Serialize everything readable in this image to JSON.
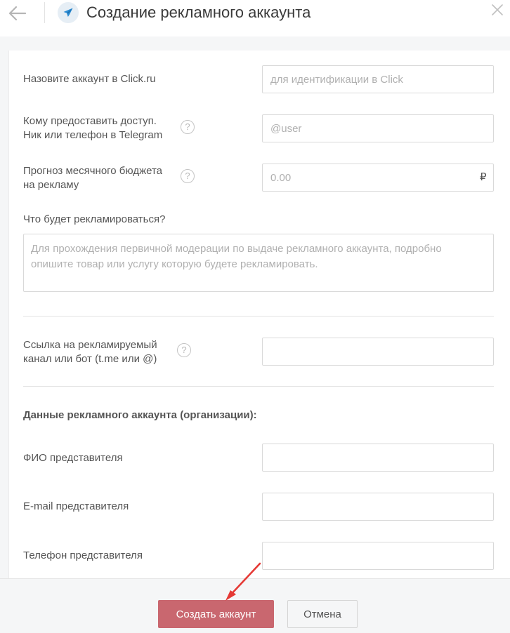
{
  "header": {
    "title": "Создание рекламного аккаунта",
    "back_icon": "arrow-left-icon",
    "app_icon": "telegram-icon",
    "close_icon": "close-icon"
  },
  "form": {
    "account_name": {
      "label": "Назовите аккаунт в Click.ru",
      "placeholder": "для идентификации в Click",
      "value": ""
    },
    "access": {
      "label_line1": "Кому предоставить доступ.",
      "label_line2": "Ник или телефон в Telegram",
      "placeholder": "@user",
      "value": ""
    },
    "budget": {
      "label_line1": "Прогноз месячного бюджета",
      "label_line2": "на рекламу",
      "placeholder": "0.00",
      "currency": "₽",
      "value": ""
    },
    "promote": {
      "label": "Что будет рекламироваться?",
      "placeholder": "Для прохождения первичной модерации по выдаче рекламного аккаунта, подробно опишите товар или услугу которую будете рекламировать.",
      "value": ""
    },
    "channel_link": {
      "label_line1": "Ссылка на рекламируемый",
      "label_line2": "канал или бот (t.me или @)",
      "value": ""
    },
    "org_section_title": "Данные рекламного аккаунта (организации):",
    "rep_name": {
      "label": "ФИО представителя",
      "value": ""
    },
    "rep_email": {
      "label": "E-mail представителя",
      "value": ""
    },
    "rep_phone": {
      "label": "Телефон представителя",
      "value": ""
    },
    "help_glyph": "?"
  },
  "footer": {
    "create_label": "Создать аккаунт",
    "cancel_label": "Отмена"
  },
  "colors": {
    "primary_button": "#c9676f",
    "annotation_arrow": "#e53935",
    "telegram_blue": "#2a8bd3"
  }
}
